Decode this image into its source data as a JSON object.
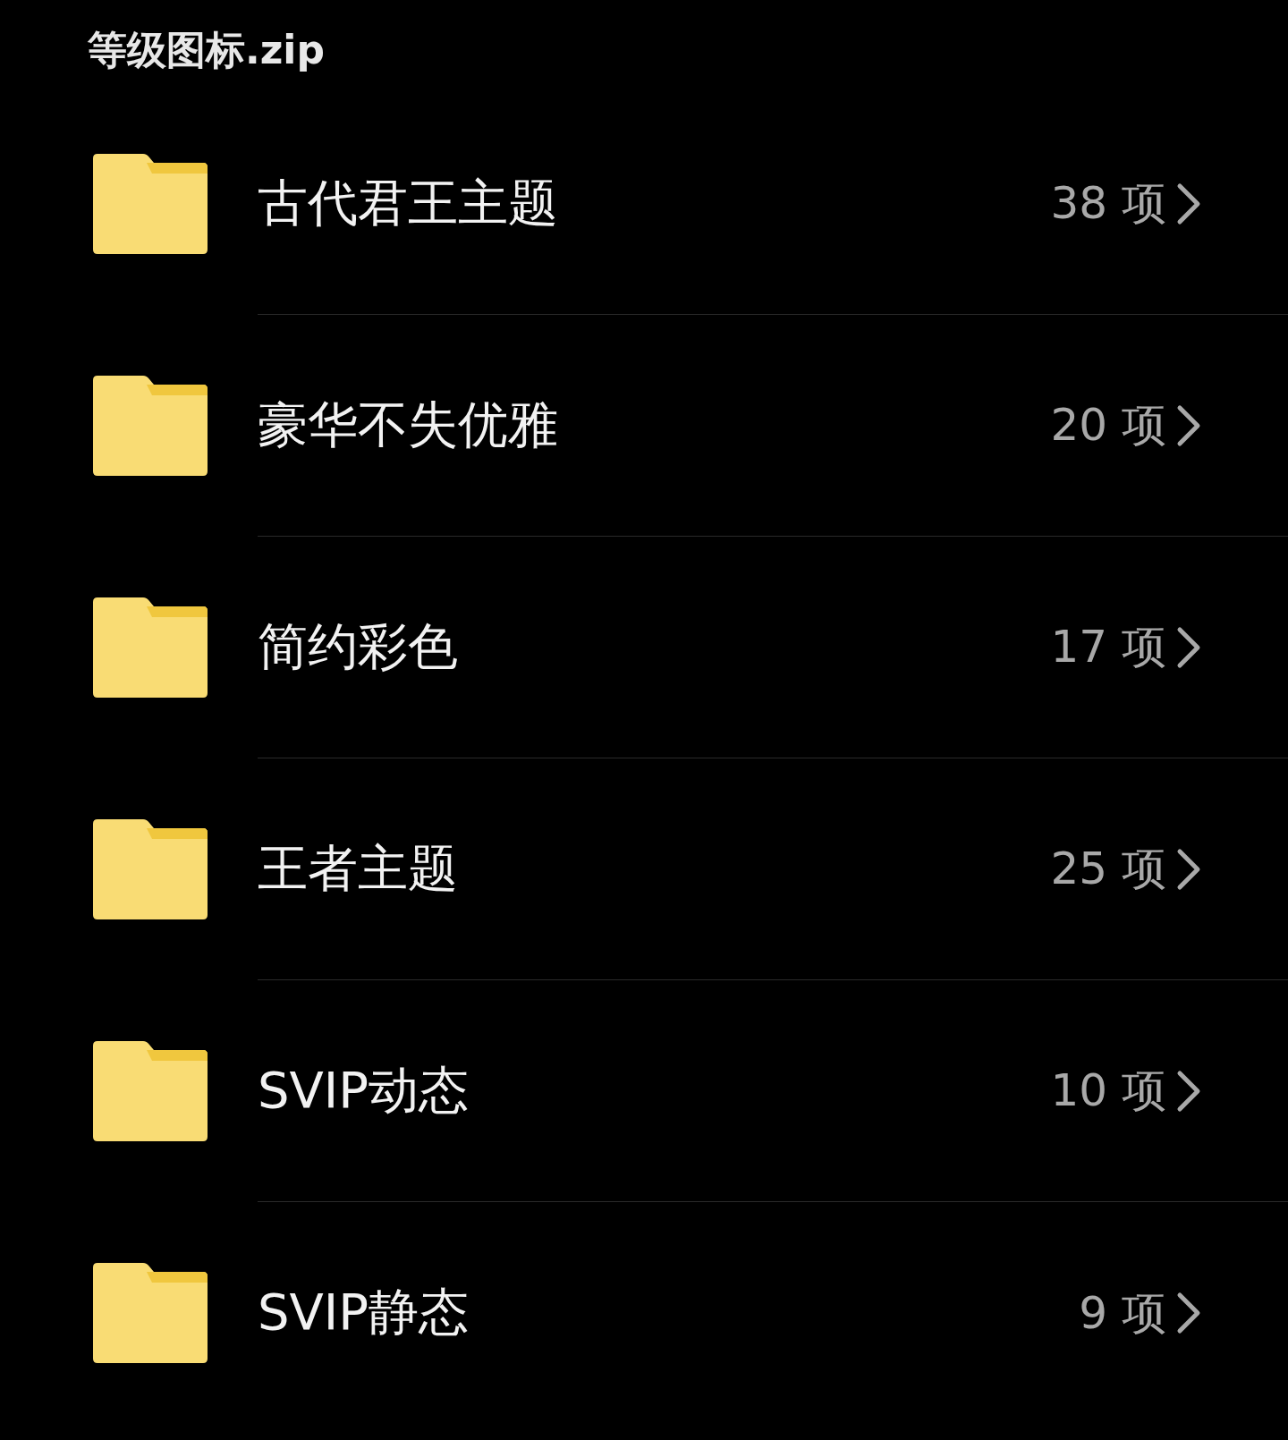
{
  "title": "等级图标.zip",
  "folders": [
    {
      "name": "古代君王主题",
      "count": "38 项"
    },
    {
      "name": "豪华不失优雅",
      "count": "20 项"
    },
    {
      "name": "简约彩色",
      "count": "17 项"
    },
    {
      "name": "王者主题",
      "count": "25 项"
    },
    {
      "name": "SVIP动态",
      "count": "10 项"
    },
    {
      "name": "SVIP静态",
      "count": "9 项"
    }
  ]
}
